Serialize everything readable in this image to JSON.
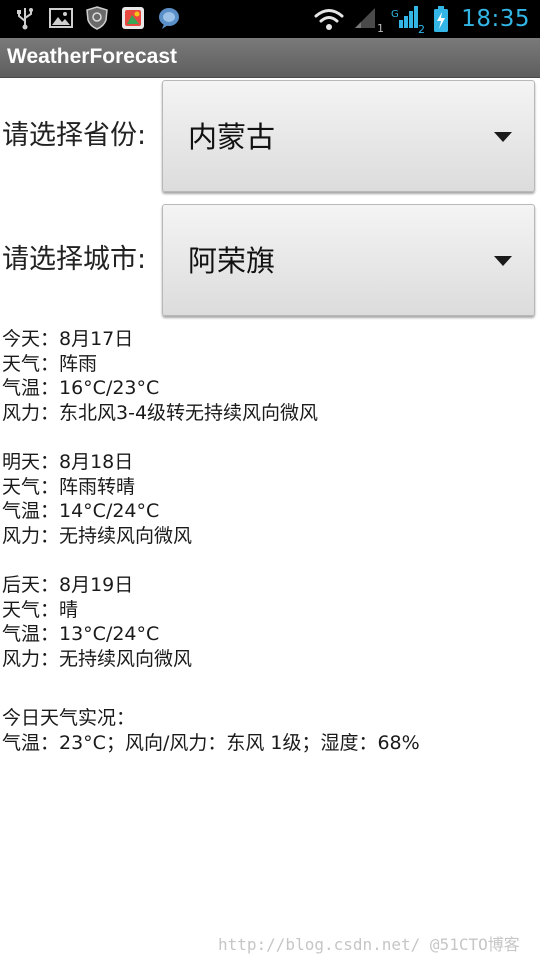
{
  "status_bar": {
    "time": "18:35",
    "icons": [
      "usb-icon",
      "image-icon",
      "shield-icon",
      "app-icon",
      "chat-icon",
      "wifi-icon",
      "signal-1-icon",
      "signal-2-icon",
      "battery-icon"
    ],
    "sim1_label": "1",
    "sim2_label": "2",
    "accent_color": "#33b5e5"
  },
  "app": {
    "title": "WeatherForecast"
  },
  "province": {
    "label": "请选择省份:",
    "selected": "内蒙古"
  },
  "city": {
    "label": "请选择城市:",
    "selected": "阿荣旗"
  },
  "forecast": [
    {
      "date": "今天：8月17日",
      "weather": "天气：阵雨",
      "temperature": "气温：16°C/23°C",
      "wind": "风力：东北风3-4级转无持续风向微风"
    },
    {
      "date": "明天：8月18日",
      "weather": "天气：阵雨转晴",
      "temperature": "气温：14°C/24°C",
      "wind": "风力：无持续风向微风"
    },
    {
      "date": "后天：8月19日",
      "weather": "天气：晴",
      "temperature": "气温：13°C/24°C",
      "wind": "风力：无持续风向微风"
    }
  ],
  "current": {
    "title": "今日天气实况：",
    "details": "气温：23°C；风向/风力：东风 1级；湿度：68%"
  },
  "watermark": "http://blog.csdn.net/ @51CTO博客"
}
